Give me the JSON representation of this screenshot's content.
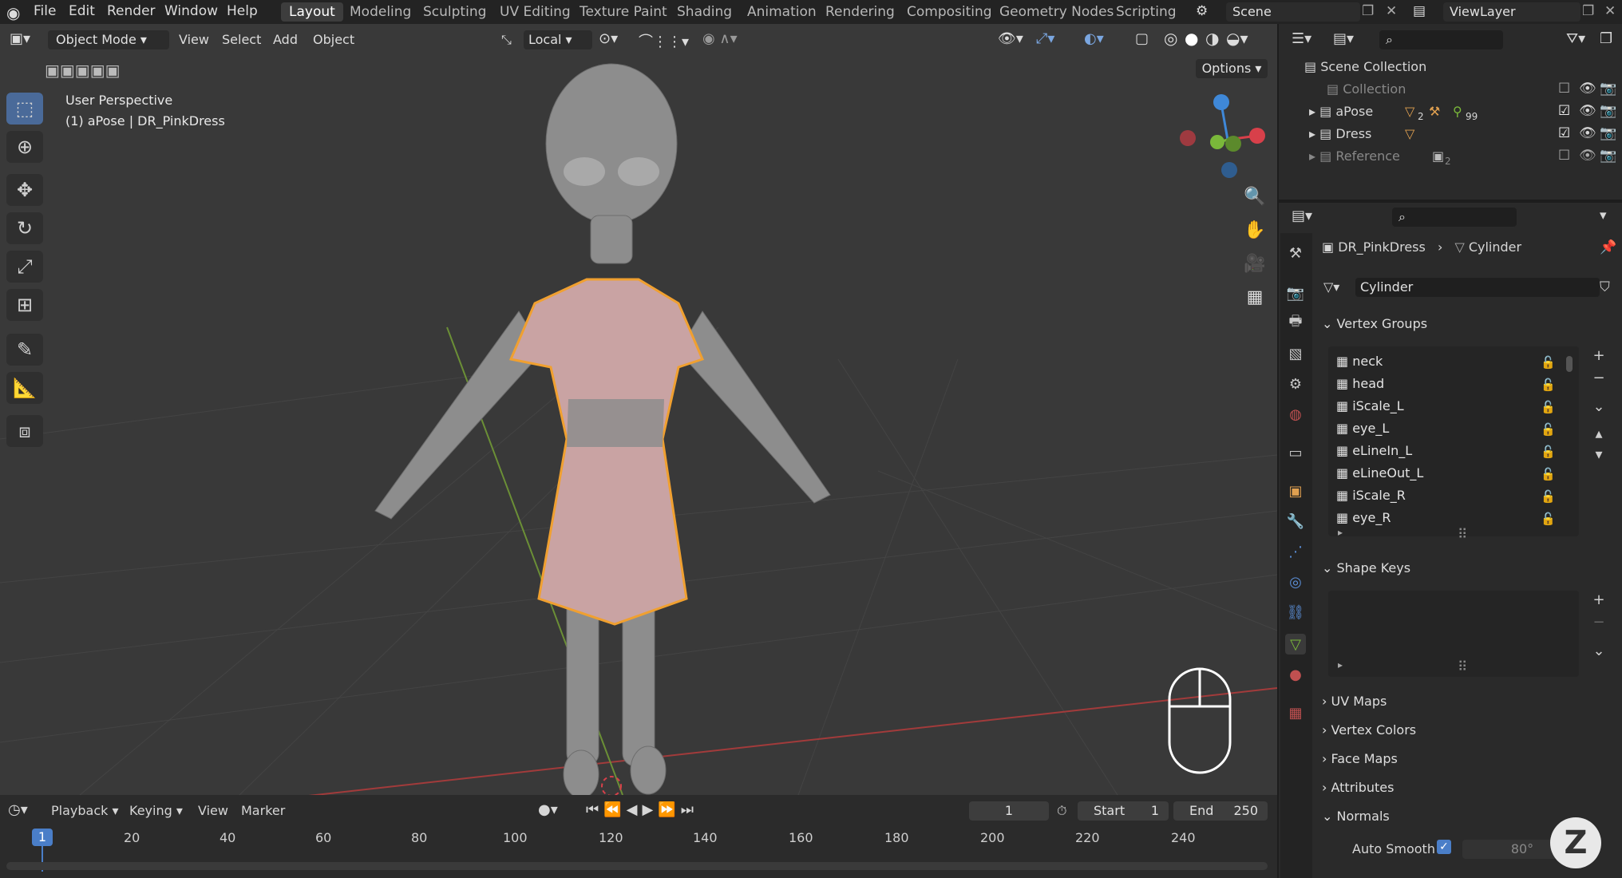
{
  "menu": {
    "items": [
      "File",
      "Edit",
      "Render",
      "Window",
      "Help"
    ],
    "workspaces": [
      "Layout",
      "Modeling",
      "Sculpting",
      "UV Editing",
      "Texture Paint",
      "Shading",
      "Animation",
      "Rendering",
      "Compositing",
      "Geometry Nodes",
      "Scripting"
    ],
    "active_workspace": "Layout",
    "scene": "Scene",
    "view_layer": "ViewLayer"
  },
  "viewport": {
    "mode": "Object Mode",
    "menus": [
      "View",
      "Select",
      "Add",
      "Object"
    ],
    "transform_orientation": "Local",
    "options_label": "Options",
    "info_line1": "User Perspective",
    "info_line2": "(1) aPose | DR_PinkDress"
  },
  "outliner": {
    "root": "Scene Collection",
    "rows": [
      {
        "name": "Collection",
        "badge": ""
      },
      {
        "name": "aPose",
        "badge": "2",
        "badge2": "99"
      },
      {
        "name": "Dress",
        "badge": ""
      },
      {
        "name": "Reference",
        "badge": "2"
      }
    ]
  },
  "properties": {
    "breadcrumb_object": "DR_PinkDress",
    "breadcrumb_data": "Cylinder",
    "mesh_name": "Cylinder",
    "panels": {
      "vertex_groups": "Vertex Groups",
      "shape_keys": "Shape Keys",
      "uv_maps": "UV Maps",
      "vertex_colors": "Vertex Colors",
      "face_maps": "Face Maps",
      "attributes": "Attributes",
      "normals": "Normals"
    },
    "vertex_groups": [
      "neck",
      "head",
      "iScale_L",
      "eye_L",
      "eLineIn_L",
      "eLineOut_L",
      "iScale_R",
      "eye_R"
    ],
    "auto_smooth_label": "Auto Smooth",
    "auto_smooth_angle": "80°"
  },
  "timeline": {
    "menus": [
      "Playback",
      "Keying",
      "View",
      "Marker"
    ],
    "current_frame": "1",
    "start_label": "Start",
    "start": "1",
    "end_label": "End",
    "end": "250",
    "ticks": [
      "1",
      "20",
      "40",
      "60",
      "80",
      "100",
      "120",
      "140",
      "160",
      "180",
      "200",
      "220",
      "240"
    ]
  },
  "colors": {
    "accent_blue": "#4a6a99",
    "selection_orange": "#f0a030",
    "dress_pink": "#c9a3a3",
    "axis_x": "#d8404a",
    "axis_y": "#7ab83a",
    "axis_z": "#3f88d8"
  }
}
